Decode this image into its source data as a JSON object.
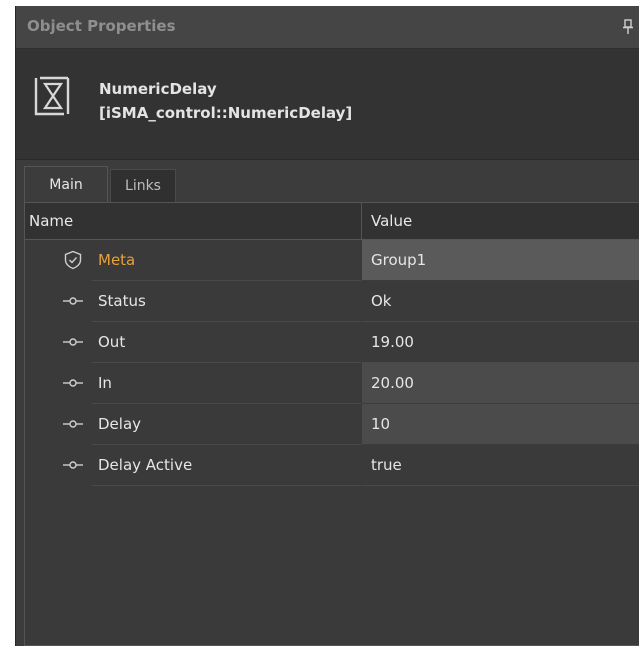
{
  "panel": {
    "title": "Object Properties",
    "pin_icon": "pin-icon"
  },
  "object": {
    "icon": "hourglass-icon",
    "name": "NumericDelay",
    "type": "[iSMA_control::NumericDelay]"
  },
  "tabs": [
    {
      "label": "Main",
      "active": true
    },
    {
      "label": "Links",
      "active": false
    }
  ],
  "grid": {
    "columns": {
      "name": "Name",
      "value": "Value"
    },
    "rows": [
      {
        "icon": "shield-check-icon",
        "name": "Meta",
        "value": "Group1",
        "highlight": true
      },
      {
        "icon": "slot-connector-icon",
        "name": "Status",
        "value": "Ok"
      },
      {
        "icon": "slot-connector-icon",
        "name": "Out",
        "value": "19.00"
      },
      {
        "icon": "slot-connector-icon",
        "name": "In",
        "value": "20.00"
      },
      {
        "icon": "slot-connector-icon",
        "name": "Delay",
        "value": "10"
      },
      {
        "icon": "slot-connector-icon",
        "name": "Delay Active",
        "value": "true"
      }
    ]
  },
  "colors": {
    "meta_label": "#e8a13a",
    "panel_bg": "#3c3c3c"
  }
}
